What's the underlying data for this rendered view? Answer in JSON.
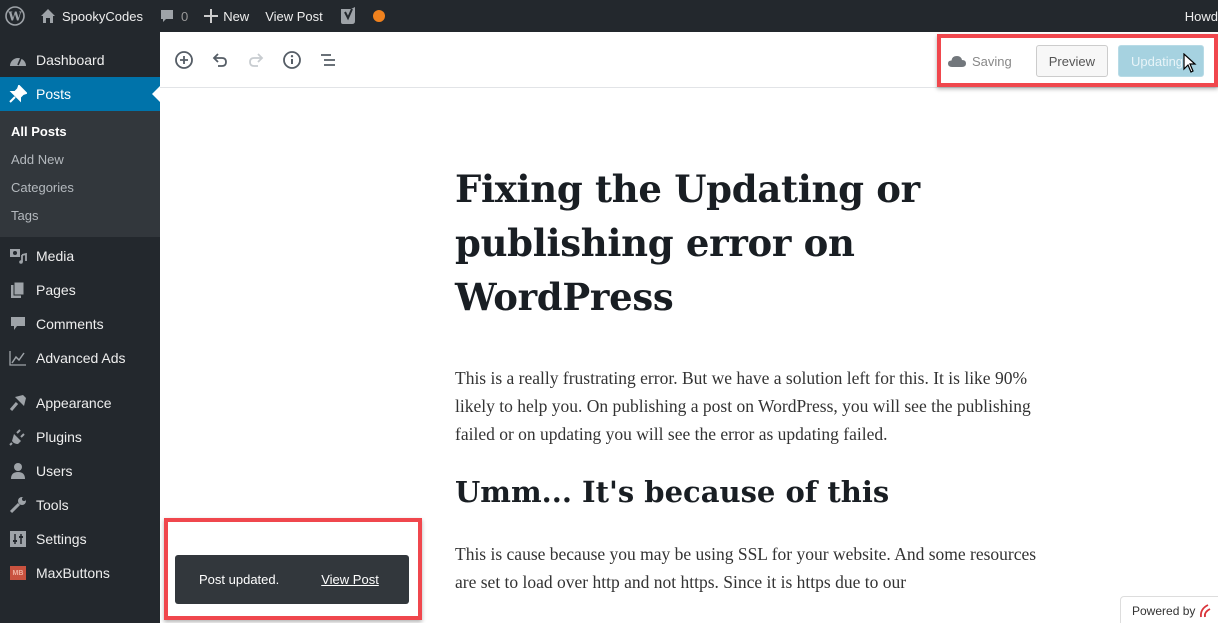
{
  "admin_bar": {
    "site_name": "SpookyCodes",
    "comments_count": "0",
    "new_label": "New",
    "view_post_label": "View Post",
    "howdy": "Howd",
    "status_dot_color": "#f0821e"
  },
  "sidebar": {
    "items": [
      {
        "label": "Dashboard",
        "icon": "dashboard-icon"
      },
      {
        "label": "Posts",
        "icon": "pin-icon",
        "active": true
      },
      {
        "label": "Media",
        "icon": "media-icon"
      },
      {
        "label": "Pages",
        "icon": "pages-icon"
      },
      {
        "label": "Comments",
        "icon": "comment-icon"
      },
      {
        "label": "Advanced Ads",
        "icon": "chart-icon"
      },
      {
        "label": "Appearance",
        "icon": "brush-icon"
      },
      {
        "label": "Plugins",
        "icon": "plugin-icon"
      },
      {
        "label": "Users",
        "icon": "user-icon"
      },
      {
        "label": "Tools",
        "icon": "wrench-icon"
      },
      {
        "label": "Settings",
        "icon": "settings-icon"
      },
      {
        "label": "MaxButtons",
        "icon": "maxbuttons-icon"
      }
    ],
    "posts_submenu": [
      "All Posts",
      "Add New",
      "Categories",
      "Tags"
    ],
    "maxbuttons_badge": "MB",
    "accent_color": "#0073aa"
  },
  "editor_header": {
    "saving_label": "Saving",
    "preview_label": "Preview",
    "update_label": "Updating"
  },
  "post": {
    "title": "Fixing the Updating or publishing error on WordPress",
    "paragraph1": "This is a really frustrating error. But we have a solution left for this. It is like 90% likely to help you. On publishing a post on WordPress, you will see the publishing failed or on updating you will see the error as updating failed.",
    "heading2": "Umm... It's because of this",
    "paragraph2": "This is cause because you may be using SSL for your website. And some resources are set to load over http and not https. Since it is https due to our"
  },
  "snackbar": {
    "message": "Post updated.",
    "link": "View Post"
  },
  "powered_by": "Powered by",
  "highlight_color": "#f0474d"
}
